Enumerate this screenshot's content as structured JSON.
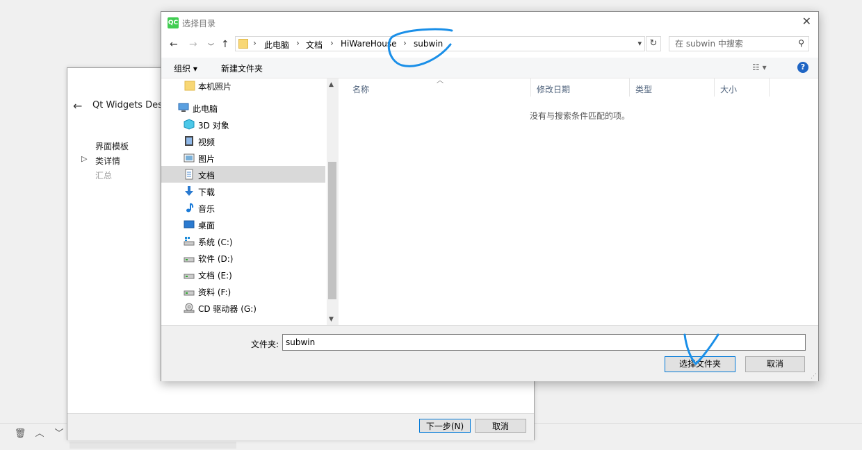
{
  "wizard": {
    "title": "Qt Widgets Desig",
    "steps": [
      "界面模板",
      "类详情",
      "汇总"
    ],
    "current_step_marker": "▷",
    "next_button": "下一步(N)",
    "cancel_button": "取消"
  },
  "dialog": {
    "logo": "QC",
    "title": "选择目录",
    "address": {
      "crumbs": [
        "此电脑",
        "文档",
        "HiWareHouse",
        "subwin"
      ],
      "separator": "›"
    },
    "search_placeholder": "在 subwin 中搜索",
    "toolbar": {
      "organize": "组织 ▾",
      "new_folder": "新建文件夹",
      "help": "?"
    },
    "tree": [
      {
        "label": "本机照片",
        "icon": "folder-icon"
      },
      {
        "label": "此电脑",
        "icon": "computer-icon"
      },
      {
        "label": "3D 对象",
        "icon": "cube-icon"
      },
      {
        "label": "视频",
        "icon": "video-icon"
      },
      {
        "label": "图片",
        "icon": "picture-icon"
      },
      {
        "label": "文档",
        "icon": "document-icon",
        "selected": true
      },
      {
        "label": "下载",
        "icon": "download-icon"
      },
      {
        "label": "音乐",
        "icon": "music-icon"
      },
      {
        "label": "桌面",
        "icon": "desktop-icon"
      },
      {
        "label": "系统 (C:)",
        "icon": "system-drive-icon"
      },
      {
        "label": "软件 (D:)",
        "icon": "drive-icon"
      },
      {
        "label": "文档 (E:)",
        "icon": "drive-icon"
      },
      {
        "label": "资料 (F:)",
        "icon": "drive-icon"
      },
      {
        "label": "CD 驱动器 (G:)",
        "icon": "cd-drive-icon"
      }
    ],
    "columns": [
      "名称",
      "修改日期",
      "类型",
      "大小"
    ],
    "empty_message": "没有与搜索条件匹配的项。",
    "folder_label": "文件夹:",
    "folder_value": "subwin",
    "select_button": "选择文件夹",
    "cancel_button": "取消"
  },
  "colors": {
    "accent": "#0078d7",
    "annotation": "#1a8fe8",
    "selection": "#d9d9d9",
    "qt_green": "#41cd52"
  }
}
